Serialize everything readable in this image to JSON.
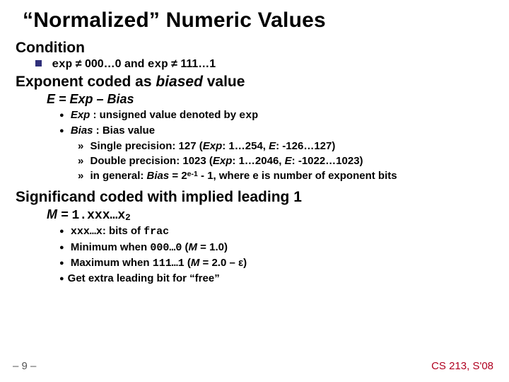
{
  "title": "“Normalized” Numeric Values",
  "s1": {
    "head": "Condition",
    "line_pre": "exp",
    "line_mid1": " ≠ 000…0 and ",
    "line_mid2": "exp",
    "line_end": " ≠ 111…1"
  },
  "s2": {
    "head_a": "Exponent coded as ",
    "head_b": "biased",
    "head_c": " value",
    "formula": "E  =  Exp – Bias",
    "d1a": "Exp",
    "d1b": " : unsigned value denoted by ",
    "d1c": "exp",
    "d2a": "Bias",
    "d2b": " : Bias value",
    "sub1a": "Single precision: 127 (",
    "sub1b": "Exp",
    "sub1c": ": 1…254, ",
    "sub1d": "E",
    "sub1e": ": -126…127)",
    "sub2a": "Double precision: 1023 (",
    "sub2b": "Exp",
    "sub2c": ": 1…2046, ",
    "sub2d": "E",
    "sub2e": ": -1022…1023)",
    "sub3a": "in general: ",
    "sub3b": "Bias",
    "sub3c": " = 2",
    "sub3d": "e-1",
    "sub3e": " - 1, where e is number of exponent bits"
  },
  "s3": {
    "head": "Significand coded with implied leading 1",
    "Mlabel": "M  =  ",
    "M1": "1.xxx…x",
    "M2": "2",
    "d1a": "xxx…x",
    "d1b": ": bits of ",
    "d1c": "frac",
    "d2a": "Minimum when ",
    "d2b": "000…0",
    "d2c": " (",
    "d2d": "M",
    "d2e": " = 1.0)",
    "d3a": "Maximum when ",
    "d3b": "111…1",
    "d3c": " (",
    "d3d": "M",
    "d3e": " = 2.0 – ε)",
    "d4": "Get extra leading bit for “free”"
  },
  "footer": {
    "left": "– 9 –",
    "right": "CS 213, S'08"
  }
}
